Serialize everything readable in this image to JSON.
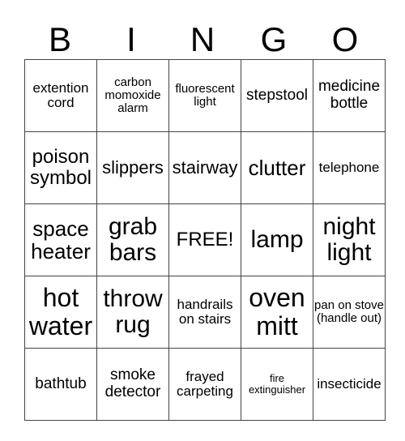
{
  "header": {
    "letters": [
      "B",
      "I",
      "N",
      "G",
      "O"
    ]
  },
  "card": {
    "rows": [
      [
        "extention cord",
        "carbon momoxide alarm",
        "fluorescent light",
        "stepstool",
        "medicine bottle"
      ],
      [
        "poison symbol",
        "slippers",
        "stairway",
        "clutter",
        "telephone"
      ],
      [
        "space heater",
        "grab bars",
        "FREE!",
        "lamp",
        "night light"
      ],
      [
        "hot water",
        "throw rug",
        "handrails on stairs",
        "oven mitt",
        "pan on stove (handle out)"
      ],
      [
        "bathtub",
        "smoke detector",
        "frayed carpeting",
        "fire extinguisher",
        "insecticide"
      ]
    ]
  }
}
